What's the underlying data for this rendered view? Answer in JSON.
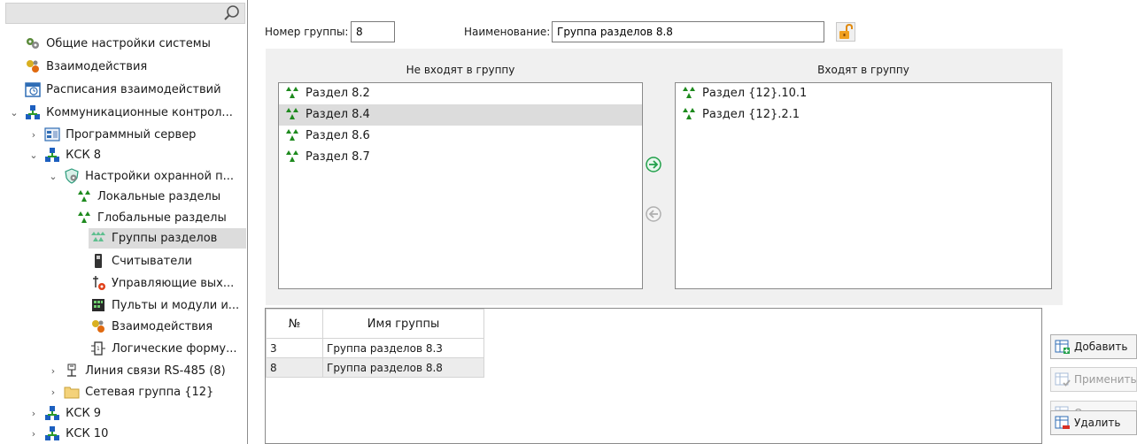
{
  "tree": {
    "items": [
      {
        "label": "Общие настройки системы",
        "icon": "settings-gears-icon"
      },
      {
        "label": "Взаимодействия",
        "icon": "interactions-icon"
      },
      {
        "label": "Расписания взаимодействий",
        "icon": "schedule-icon"
      },
      {
        "label": "Коммуникационные контрол...",
        "icon": "network-icon",
        "expanded": true
      },
      {
        "label": "Программный сервер",
        "icon": "server-icon"
      },
      {
        "label": "КСК 8",
        "icon": "network-icon",
        "expanded": true
      },
      {
        "label": "Настройки охранной п...",
        "icon": "security-settings-icon",
        "expanded": true
      },
      {
        "label": "Локальные разделы",
        "icon": "partition-icon"
      },
      {
        "label": "Глобальные разделы",
        "icon": "partition-icon"
      },
      {
        "label": "Группы разделов",
        "icon": "partition-groups-icon",
        "selected": true
      },
      {
        "label": "Считыватели",
        "icon": "reader-icon"
      },
      {
        "label": "Управляющие вых...",
        "icon": "outputs-icon"
      },
      {
        "label": "Пульты и модули и...",
        "icon": "consoles-icon"
      },
      {
        "label": "Взаимодействия",
        "icon": "interactions-icon"
      },
      {
        "label": "Логические форму...",
        "icon": "logic-formula-icon"
      },
      {
        "label": "Линия связи RS-485 (8)",
        "icon": "rs485-line-icon"
      },
      {
        "label": "Сетевая группа {12}",
        "icon": "folder-icon"
      },
      {
        "label": "КСК 9",
        "icon": "network-icon"
      },
      {
        "label": "КСК 10",
        "icon": "network-icon"
      }
    ]
  },
  "form": {
    "group_number_label": "Номер группы:",
    "group_number_value": "8",
    "name_label": "Наименование:",
    "name_value": "Группа разделов 8.8"
  },
  "lists": {
    "not_in_group_header": "Не входят в группу",
    "in_group_header": "Входят в группу",
    "not_in_group": [
      "Раздел 8.2",
      "Раздел 8.4",
      "Раздел 8.6",
      "Раздел 8.7"
    ],
    "in_group": [
      "Раздел {12}.10.1",
      "Раздел {12}.2.1"
    ]
  },
  "table": {
    "columns": [
      "№",
      "Имя группы"
    ],
    "rows": [
      {
        "num": "3",
        "name": "Группа разделов 8.3"
      },
      {
        "num": "8",
        "name": "Группа разделов 8.8"
      }
    ]
  },
  "buttons": {
    "add": "Добавить",
    "apply": "Применить",
    "cancel": "Отменить",
    "delete": "Удалить"
  },
  "colors": {
    "selection": "#dcdcdc",
    "partition_green": "#1e8a1e",
    "move_arrow_green": "#22a04b",
    "lock_orange": "#f0a020"
  }
}
